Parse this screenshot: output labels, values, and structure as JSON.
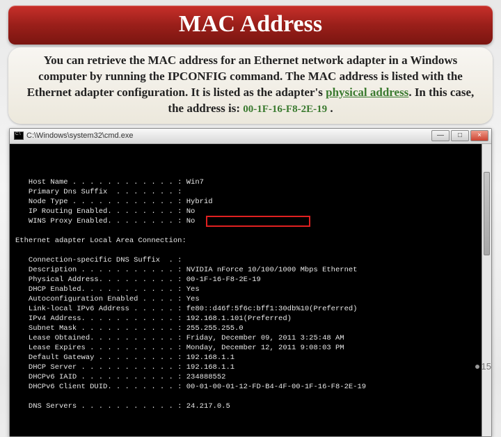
{
  "title": "MAC Address",
  "description": {
    "part1": "You can retrieve the MAC address for an Ethernet network adapter in a Windows computer by running the IPCONFIG command. The MAC address is listed with the Ethernet adapter configuration. It is listed as the adapter's ",
    "highlight": "physical address",
    "part2": ". In this case, the address is: ",
    "mac": "00-1F-16-F8-2E-19",
    "part3": " ."
  },
  "cmdwindow": {
    "title": "C:\\Windows\\system32\\cmd.exe",
    "min": "—",
    "max": "□",
    "close": "×"
  },
  "term": {
    "rows": [
      {
        "label": "Host Name . . . . . . . . . . . .",
        "value": "Win7"
      },
      {
        "label": "Primary Dns Suffix  . . . . . . .",
        "value": ""
      },
      {
        "label": "Node Type . . . . . . . . . . . .",
        "value": "Hybrid"
      },
      {
        "label": "IP Routing Enabled. . . . . . . .",
        "value": "No"
      },
      {
        "label": "WINS Proxy Enabled. . . . . . . .",
        "value": "No"
      }
    ],
    "section": "Ethernet adapter Local Area Connection:",
    "rows2": [
      {
        "label": "Connection-specific DNS Suffix  .",
        "value": ""
      },
      {
        "label": "Description . . . . . . . . . . .",
        "value": "NVIDIA nForce 10/100/1000 Mbps Ethernet"
      },
      {
        "label": "Physical Address. . . . . . . . .",
        "value": "00-1F-16-F8-2E-19"
      },
      {
        "label": "DHCP Enabled. . . . . . . . . . .",
        "value": "Yes"
      },
      {
        "label": "Autoconfiguration Enabled . . . .",
        "value": "Yes"
      },
      {
        "label": "Link-local IPv6 Address . . . . .",
        "value": "fe80::d46f:5f6c:bff1:30db%10(Preferred)"
      },
      {
        "label": "IPv4 Address. . . . . . . . . . .",
        "value": "192.168.1.101(Preferred)"
      },
      {
        "label": "Subnet Mask . . . . . . . . . . .",
        "value": "255.255.255.0"
      },
      {
        "label": "Lease Obtained. . . . . . . . . .",
        "value": "Friday, December 09, 2011 3:25:48 AM"
      },
      {
        "label": "Lease Expires . . . . . . . . . .",
        "value": "Monday, December 12, 2011 9:08:03 PM"
      },
      {
        "label": "Default Gateway . . . . . . . . .",
        "value": "192.168.1.1"
      },
      {
        "label": "DHCP Server . . . . . . . . . . .",
        "value": "192.168.1.1"
      },
      {
        "label": "DHCPv6 IAID . . . . . . . . . . .",
        "value": "234888552"
      },
      {
        "label": "DHCPv6 Client DUID. . . . . . . .",
        "value": "00-01-00-01-12-FD-B4-4F-00-1F-16-F8-2E-19"
      }
    ],
    "rows3": [
      {
        "label": "DNS Servers . . . . . . . . . . .",
        "value": "24.217.0.5"
      }
    ]
  },
  "pagenum": "15"
}
